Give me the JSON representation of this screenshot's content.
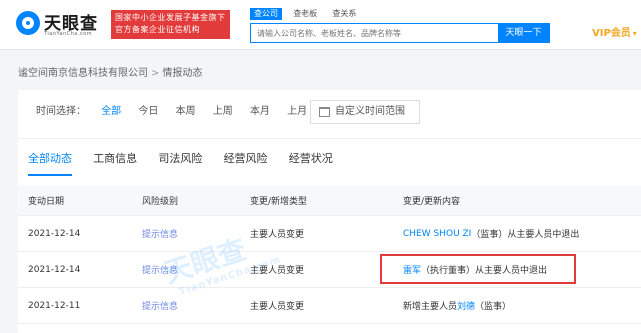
{
  "header": {
    "logo_title": "天眼查",
    "logo_sub": "TianYanCha.com",
    "badge_line1": "国家中小企业发展子基金旗下",
    "badge_line2": "官方备案企业征信机构",
    "search_tabs": [
      "查公司",
      "查老板",
      "查关系"
    ],
    "search_placeholder": "请输入公司名称、老板姓名、品牌名称等",
    "search_button": "天眼一下",
    "vip_label": "VIP会员",
    "vip_caret": "▾"
  },
  "breadcrumb": {
    "company": "谧空间南京信息科技有限公司",
    "separator": ">",
    "current": "情报动态"
  },
  "time_filter": {
    "label": "时间选择：",
    "options": [
      "全部",
      "今日",
      "本周",
      "上周",
      "本月",
      "上月"
    ],
    "custom_label": "自定义时间范围"
  },
  "tabs": [
    "全部动态",
    "工商信息",
    "司法风险",
    "经营风险",
    "经营状况"
  ],
  "table": {
    "headers": [
      "变动日期",
      "风险级别",
      "变更/新增类型",
      "变更/更新内容"
    ],
    "rows": [
      {
        "date": "2021-12-14",
        "risk": "提示信息",
        "type": "主要人员变更",
        "content_link": "CHEW SHOU ZI",
        "content_rest": "（监事）从主要人员中退出"
      },
      {
        "date": "2021-12-14",
        "risk": "提示信息",
        "type": "主要人员变更",
        "content_link": "雷军",
        "content_rest": "（执行董事）从主要人员中退出"
      },
      {
        "date": "2021-12-11",
        "risk": "提示信息",
        "type": "主要人员变更",
        "content_prefix": "新增主要人员",
        "content_link": "刘德",
        "content_rest": "（监事）"
      }
    ]
  },
  "watermark": {
    "text": "天眼查",
    "sub": "TianYanCha.com"
  }
}
